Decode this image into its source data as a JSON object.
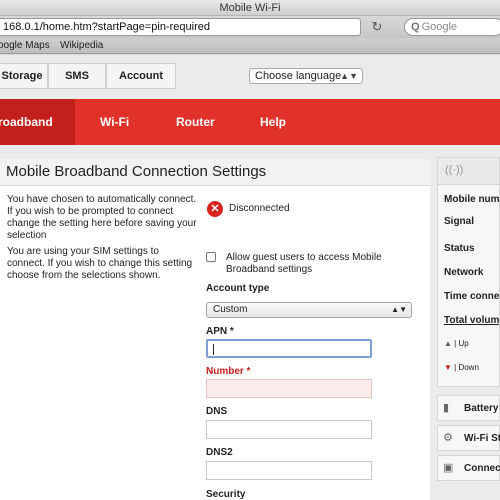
{
  "browser": {
    "window_title": "Mobile Wi-Fi",
    "url": "168.0.1/home.htm?startPage=pin-required",
    "search_placeholder": "Google",
    "bookmarks": [
      "oogle Maps",
      "Wikipedia"
    ]
  },
  "top_tabs": [
    "Storage",
    "SMS",
    "Account"
  ],
  "language_select": "Choose language",
  "nav": {
    "items": [
      "roadband",
      "Wi-Fi",
      "Router",
      "Help"
    ],
    "active": "roadband"
  },
  "main": {
    "title": "Mobile Broadband Connection Settings",
    "desc_1": "You have chosen to automatically connect. If you wish to be prompted to connect change the setting here before saving your selection",
    "desc_2": "You are using your SIM settings to connect. If you wish to change this setting choose from the selections shown.",
    "status": "Disconnected",
    "guest_label": "Allow guest users to access Mobile Broadband settings",
    "account_type_label": "Account type",
    "account_type_value": "Custom",
    "apn_label": "APN *",
    "number_label": "Number *",
    "dns_label": "DNS",
    "dns2_label": "DNS2",
    "security_label": "Security"
  },
  "side": {
    "rows": [
      "Mobile numb",
      "Signal",
      "Status",
      "Network",
      "Time connec",
      "Total volume"
    ],
    "up_label": "Up",
    "down_label": "Down",
    "boxes": [
      "Battery",
      "Wi-Fi Sta",
      "Connect"
    ]
  },
  "colors": {
    "brand_red": "#e0312a",
    "active_red": "#c4201b",
    "error_red": "#d9231d"
  }
}
